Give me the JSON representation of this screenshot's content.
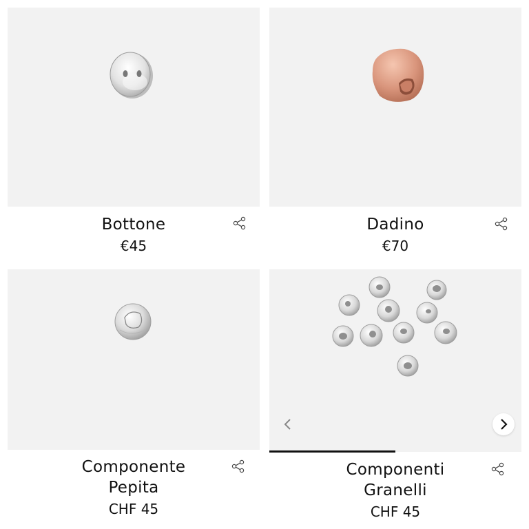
{
  "products": [
    {
      "name": "Bottone",
      "price": "€45",
      "image_icon": "silver-button-icon"
    },
    {
      "name": "Dadino",
      "price": "€70",
      "image_icon": "rose-gold-cube-bead-icon"
    },
    {
      "name": "Componente Pepita",
      "name_lines": [
        "Componente",
        "Pepita"
      ],
      "price": "CHF 45",
      "image_icon": "silver-nugget-bead-icon"
    },
    {
      "name": "Componenti Granelli",
      "name_lines": [
        "Componenti",
        "Granelli"
      ],
      "price": "CHF 45",
      "image_icon": "silver-beads-set-icon"
    }
  ],
  "carousel": {
    "active_fraction": 0.5,
    "prev_icon": "chevron-left-icon",
    "next_icon": "chevron-right-icon"
  },
  "colors": {
    "image_bg": "#f2f2f2",
    "text": "#111111",
    "rose_gold": "#d9957c",
    "silver": "#e6e6e6"
  }
}
